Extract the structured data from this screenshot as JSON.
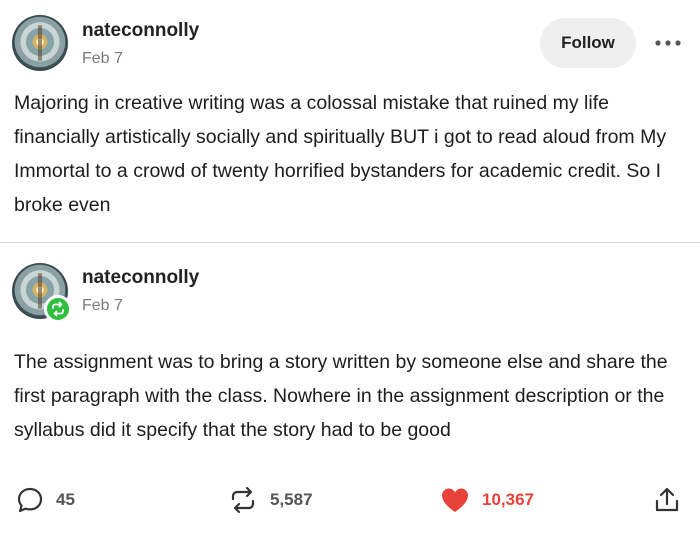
{
  "posts": [
    {
      "username": "nateconnolly",
      "date": "Feb 7",
      "text": "Majoring in creative writing was a colossal mistake that ruined my life financially artistically socially and spiritually BUT i got to read aloud from My Immortal to a crowd of twenty horrified bystanders for academic credit. So I broke even"
    },
    {
      "username": "nateconnolly",
      "date": "Feb 7",
      "text": "The assignment was to bring a story written by someone else and share the first paragraph with the class. Nowhere in the assignment description or the syllabus did it specify that the story had to be good"
    }
  ],
  "header": {
    "follow_label": "Follow"
  },
  "actions": {
    "replies": "45",
    "reblogs": "5,587",
    "likes": "10,367"
  },
  "colors": {
    "like": "#e8433a",
    "reblog_badge": "#2fbf3e",
    "follow_bg": "#efefef"
  },
  "icons": {
    "more": "more-dots-icon",
    "reply": "comment-bubble-icon",
    "reblog": "reblog-arrows-icon",
    "like": "heart-icon",
    "share": "share-upload-icon"
  }
}
